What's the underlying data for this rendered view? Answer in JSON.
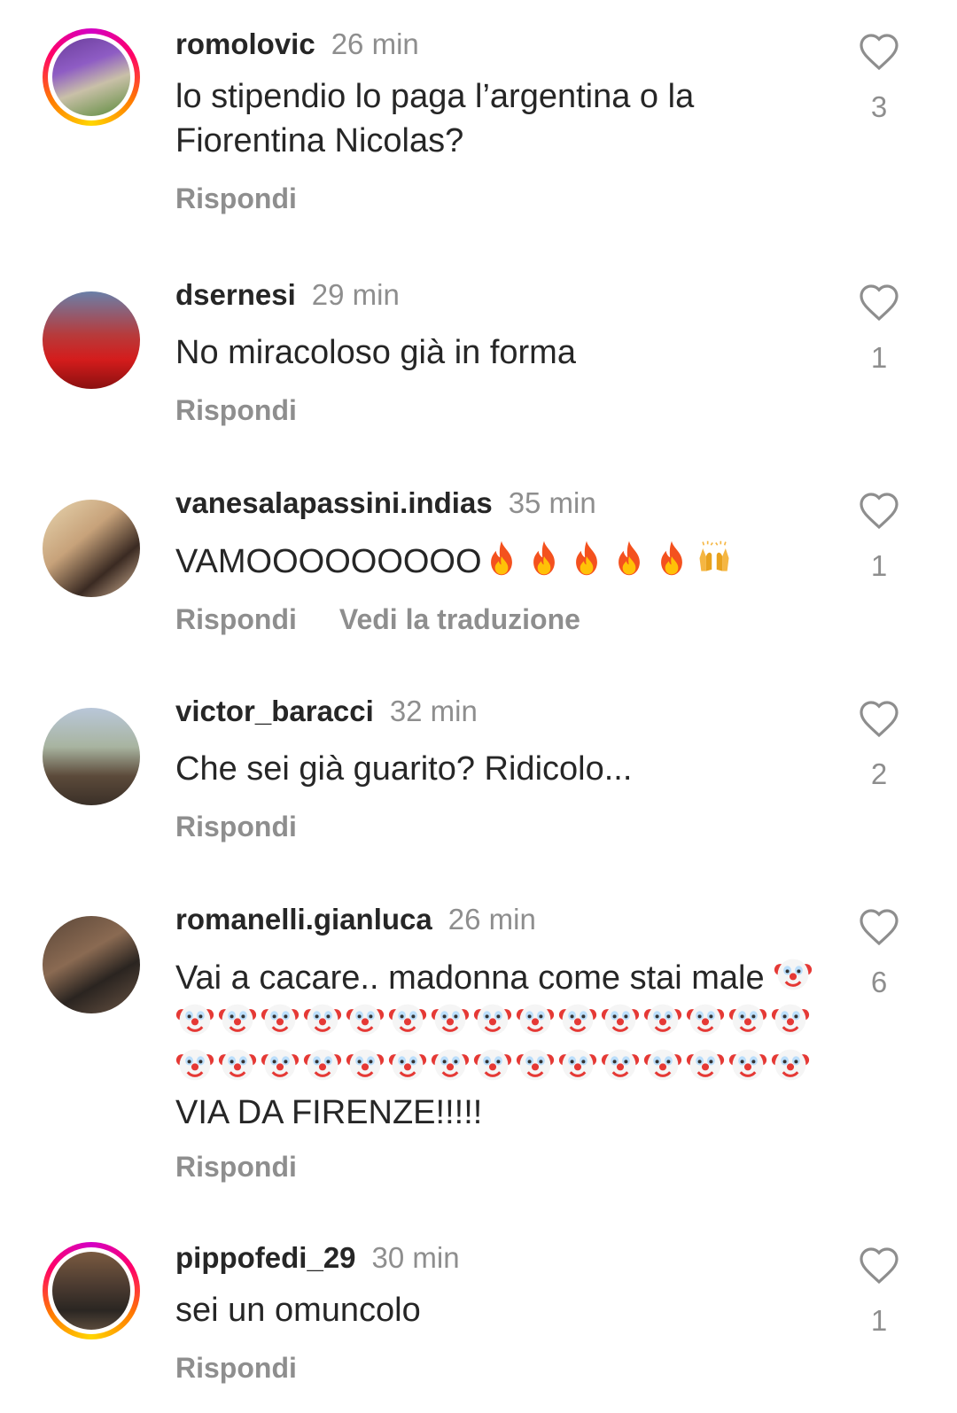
{
  "comments": [
    {
      "user": "romolovic",
      "time": "26 min",
      "text": "lo stipendio lo paga l’argentina o la Fiorentina Nicolas?",
      "reply": "Rispondi",
      "likes": "3"
    },
    {
      "user": "dsernesi",
      "time": "29 min",
      "text": "No miracoloso già in forma",
      "reply": "Rispondi",
      "likes": "1"
    },
    {
      "user": "vanesalapassini.indias",
      "time": "35 min",
      "text": "VAMOOOOOOOOO",
      "emojis": [
        "fire",
        "fire",
        "fire",
        "fire",
        "fire",
        "raising-hands"
      ],
      "reply": "Rispondi",
      "translate": "Vedi la traduzione",
      "likes": "1"
    },
    {
      "user": "victor_baracci",
      "time": "32 min",
      "text": "Che sei già guarito? Ridicolo...",
      "reply": "Rispondi",
      "likes": "2"
    },
    {
      "user": "romanelli.gianluca",
      "time": "26 min",
      "text_start": "Vai a cacare.. madonna come stai male",
      "emoji": "clown",
      "emoji_count": 31,
      "text_end": "VIA DA FIRENZE!!!!!",
      "reply": "Rispondi",
      "likes": "6"
    },
    {
      "user": "pippofedi_29",
      "time": "30 min",
      "text": "sei un omuncolo",
      "reply": "Rispondi",
      "likes": "1"
    }
  ],
  "colors": {
    "text": "#262626",
    "secondary": "#8e8e8e",
    "background": "#ffffff"
  }
}
